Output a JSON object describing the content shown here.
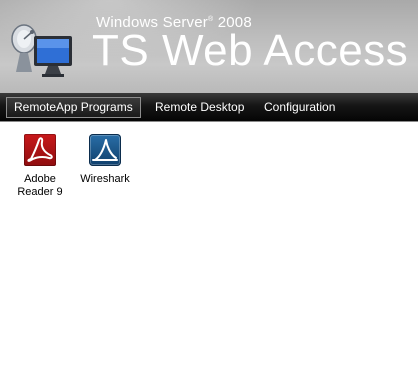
{
  "header": {
    "product": "Windows Server",
    "product_mark": "®",
    "product_year": " 2008",
    "title": "TS Web Access"
  },
  "nav": {
    "items": [
      {
        "label": "RemoteApp Programs",
        "active": true
      },
      {
        "label": "Remote Desktop",
        "active": false
      },
      {
        "label": "Configuration",
        "active": false
      }
    ]
  },
  "programs": [
    {
      "label": "Adobe Reader 9",
      "icon": "adobe-reader-icon"
    },
    {
      "label": "Wireshark",
      "icon": "wireshark-icon"
    }
  ],
  "colors": {
    "navbar": "#0a0a0a",
    "adobe_red": "#c8191b",
    "wireshark_blue": "#1f5e94"
  }
}
